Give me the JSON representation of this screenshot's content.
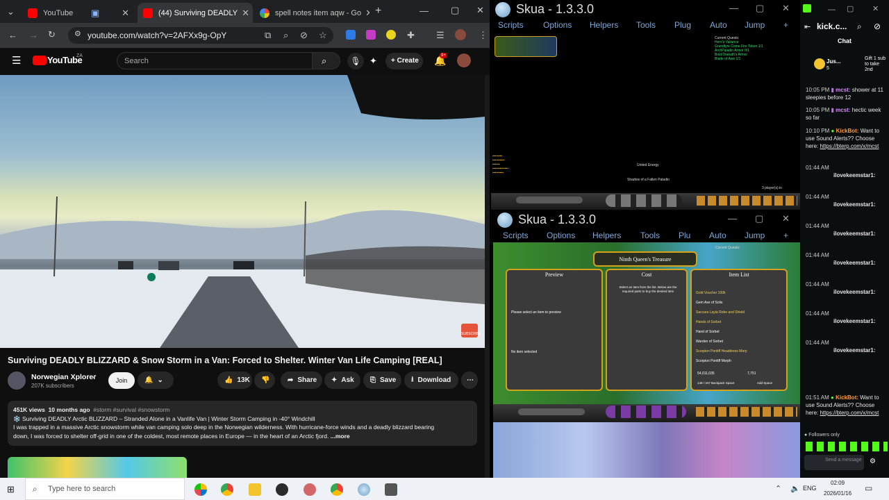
{
  "browser": {
    "tabs": [
      {
        "title": "YouTube"
      },
      {
        "title": "(44) Surviving DEADLY"
      },
      {
        "title": "spell notes item aqw - Go"
      }
    ],
    "new_tab": "+",
    "url": "youtube.com/watch?v=2AFXx9g-OpY"
  },
  "youtube": {
    "logo": "YouTube",
    "region": "ZA",
    "search_placeholder": "Search",
    "create": "Create",
    "notif_count": "9+",
    "video_title": "Surviving DEADLY BLIZZARD & Snow Storm in a Van: Forced to Shelter. Winter Van Life Camping [REAL]",
    "channel": "Norwegian Xplorer",
    "subscribers": "207K subscribers",
    "join": "Join",
    "likes": "13K",
    "share": "Share",
    "ask": "Ask",
    "save": "Save",
    "download": "Download",
    "views": "451K views",
    "age": "10 months ago",
    "tags": "#storm #survival #snowstorm",
    "desc_line1": "❄️ Surviving DEADLY Arctic BLIZZARD – Stranded Alone in a Vanlife Van | Winter Storm Camping in -40° Windchill",
    "desc_line2": "I was trapped in a massive Arctic snowstorm while van camping solo deep in the Norwegian wilderness. With hurricane-force winds and a deadly blizzard bearing",
    "desc_line3": "down, I was forced to shelter off-grid in one of the coldest, most remote places in Europe — in the heart of an Arctic fjord.",
    "more": "...more",
    "subscribe_badge": "SUBSCRIBE"
  },
  "skua1": {
    "title": "Skua - 1.3.3.0",
    "menu": [
      "Scripts",
      "Options",
      "Helpers",
      "Tools",
      "Plug",
      "Auto",
      "Jump"
    ],
    "plus": "+",
    "quests_header": "Current Quests:",
    "quests": [
      "Hero's Valiance",
      "Grandlyre Come Fire Token 1/1",
      "ArchPaladin Armor 0/1",
      "Bold Drakath's Armor",
      "Blade of Awe 1/1"
    ],
    "npc1": "United Energy",
    "npc2": "Shadow of a Fallen Paladin",
    "players": "3 player(s) in"
  },
  "skua2": {
    "title": "Skua - 1.3.3.0",
    "menu": [
      "Scripts",
      "Options",
      "Helpers",
      "Tools",
      "Plu",
      "Auto",
      "Jump"
    ],
    "plus": "+",
    "shop_title": "Ninth Queen's Treasure",
    "preview": "Preview",
    "cost": "Cost",
    "item_list": "Item List",
    "preview_hint": "Please select an item to preview",
    "no_item": "No item selected",
    "cost_hint": "Select an item from the list. Below are the required parts to buy the desired item",
    "items": [
      "Gold Voucher 100k",
      "Gem Axe of Solis",
      "Saccara Layla Robe and Shield",
      "Hands of Sorbet",
      "Hand of Sorbet",
      "Warden of Sorbet",
      "Scorpion Pontiff Headdress Morp",
      "Scorpion Pontiff Morph"
    ],
    "gold": "54,011,035",
    "acs": "7,751",
    "backpack": "148 / 347 Backpack Space",
    "add_space": "Add Space"
  },
  "kick": {
    "channel": "kick.c...",
    "chat_title": "Chat",
    "gift_user": "Jus...",
    "gift_count": "5",
    "gift_text": "Gift 1 sub to take 2nd",
    "messages": [
      {
        "time": "10:05 PM",
        "user": "mcst:",
        "text": "shower at 11 sleepies before 12"
      },
      {
        "time": "10:05 PM",
        "user": "mcst:",
        "text": "hectic week so far"
      },
      {
        "time": "10:10 PM",
        "user": "KickBot:",
        "text": "Want to use Sound Alerts?? Choose here:",
        "link": "https://bterp.com/x/mcst"
      },
      {
        "time": "01:44 AM",
        "user": "ilovekeemstar1:",
        "text": ""
      },
      {
        "time": "01:44 AM",
        "user": "ilovekeemstar1:",
        "text": ""
      },
      {
        "time": "01:44 AM",
        "user": "ilovekeemstar1:",
        "text": ""
      },
      {
        "time": "01:44 AM",
        "user": "ilovekeemstar1:",
        "text": ""
      },
      {
        "time": "01:44 AM",
        "user": "ilovekeemstar1:",
        "text": ""
      },
      {
        "time": "01:44 AM",
        "user": "ilovekeemstar1:",
        "text": ""
      },
      {
        "time": "01:44 AM",
        "user": "ilovekeemstar1:",
        "text": ""
      },
      {
        "time": "01:51 AM",
        "user": "KickBot:",
        "text": "Want to use Sound Alerts?? Choose here:",
        "link": "https://bterp.com/x/mcst"
      }
    ],
    "followers_only": "Followers only",
    "send_placeholder": "Send a message"
  },
  "taskbar": {
    "search": "Type here to search",
    "lang": "ENG",
    "time": "02:09",
    "date": "2026/01/16"
  },
  "colors": {
    "yt_bg": "#0f0f0f",
    "kick_green": "#53fc18",
    "skua_menu": "#7ea8d8",
    "taskbar": "#eef1f6"
  }
}
